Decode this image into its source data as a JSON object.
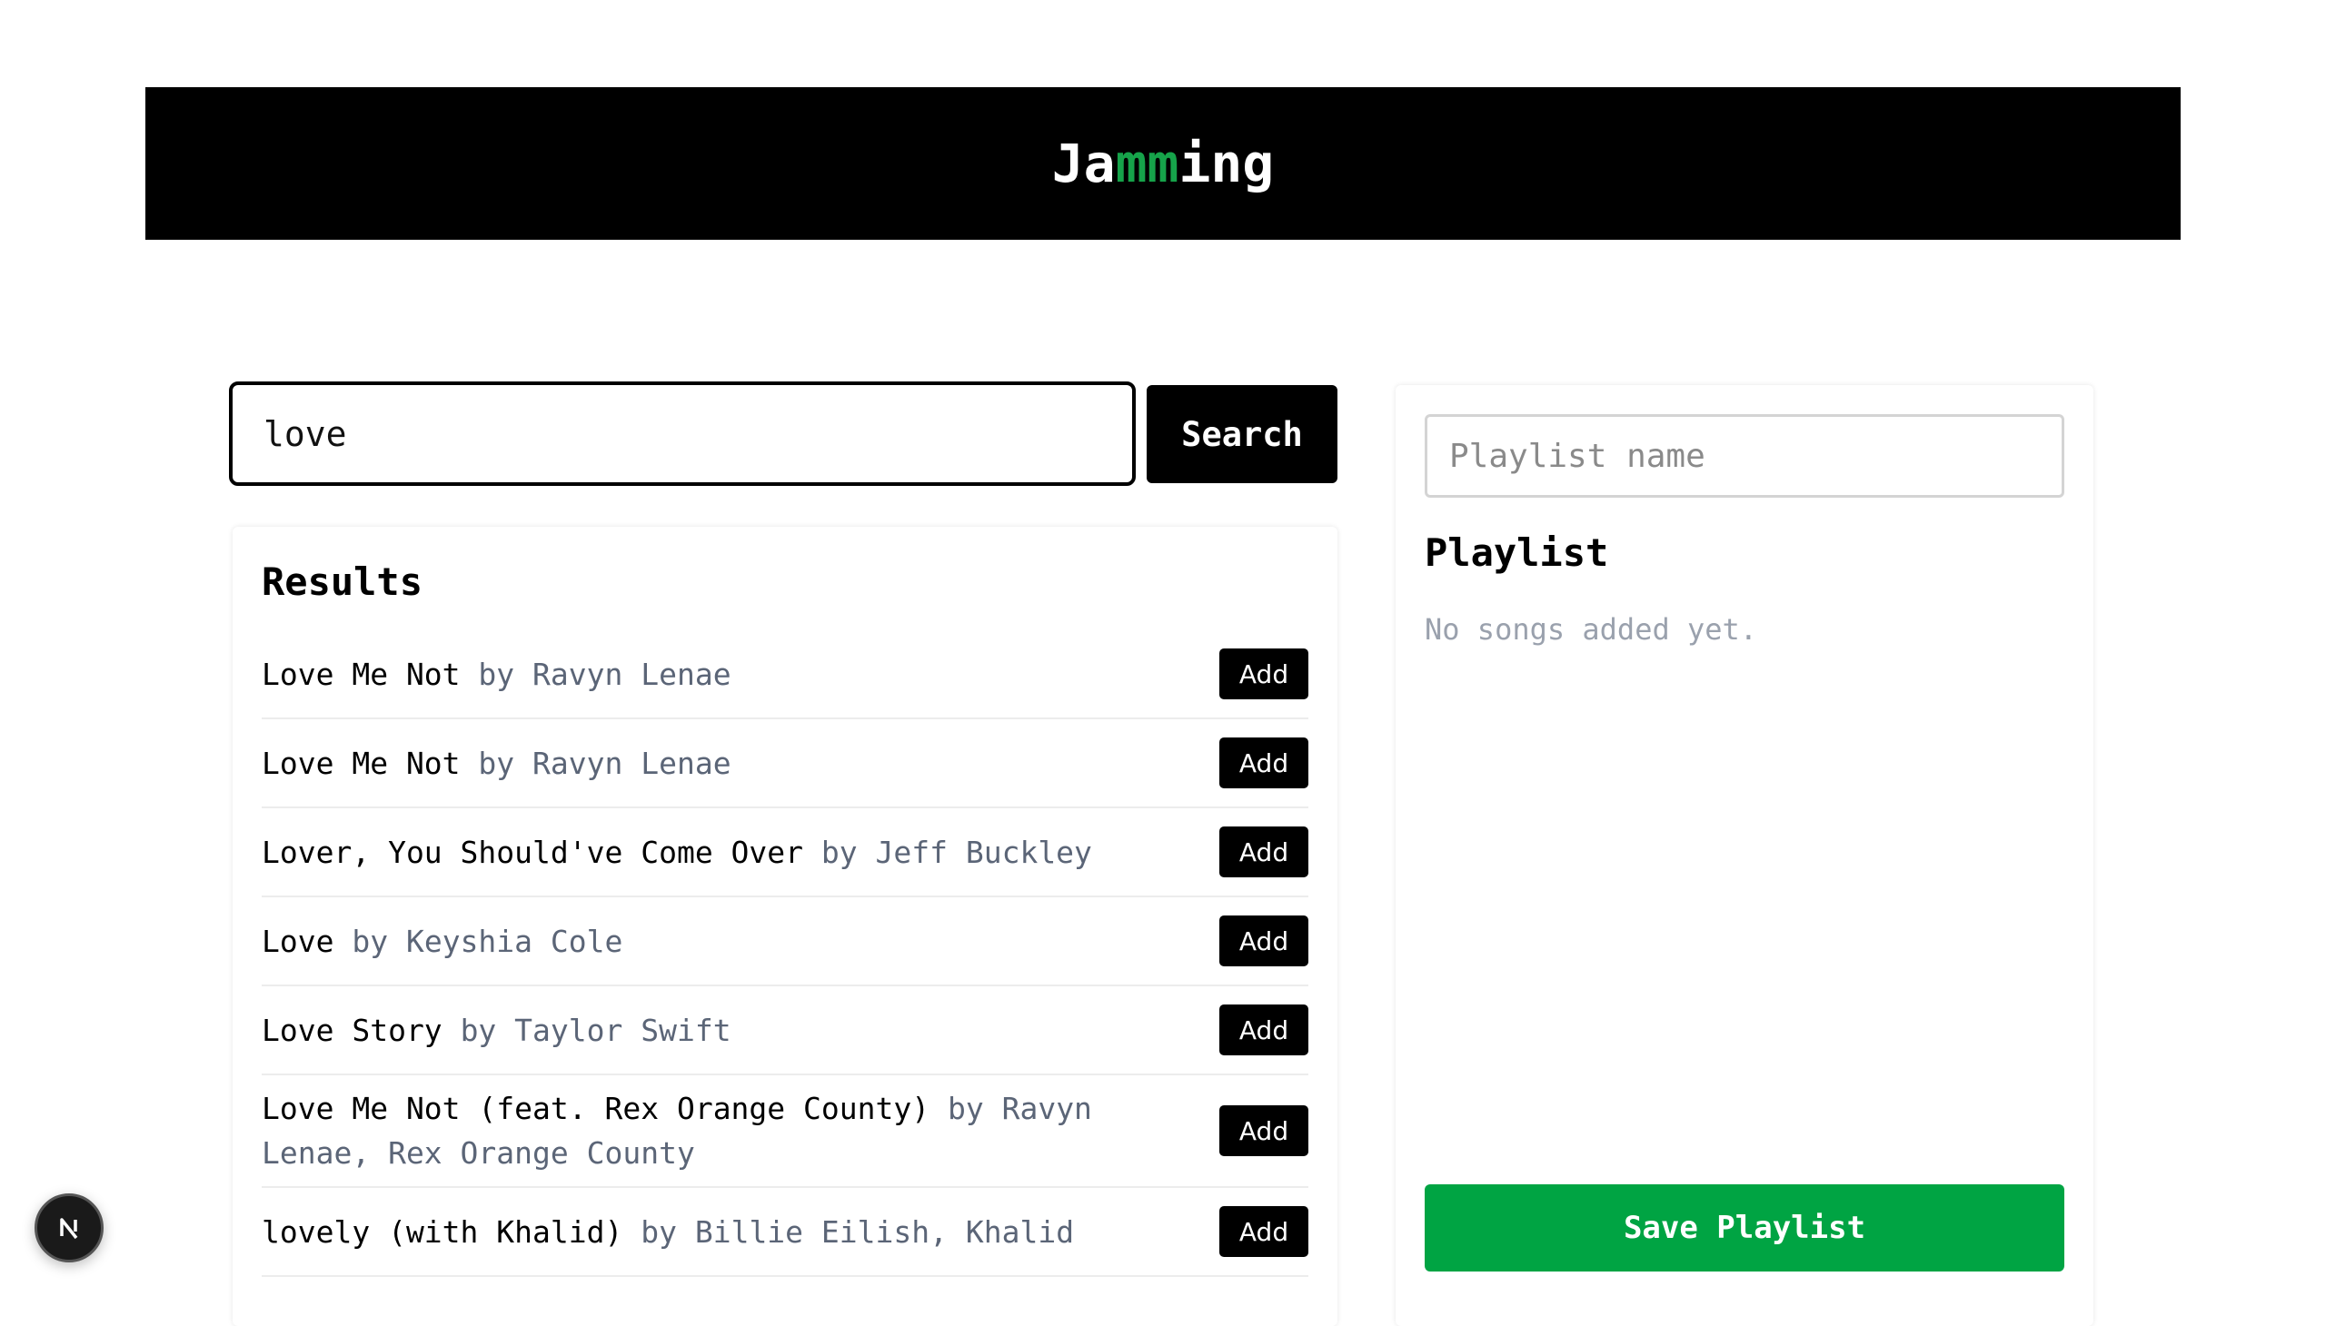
{
  "app": {
    "logo_part1": "Ja",
    "logo_accent": "mm",
    "logo_part2": "ing",
    "accent_color": "#16a34a"
  },
  "search": {
    "value": "love",
    "button_label": "Search"
  },
  "results": {
    "title": "Results",
    "add_label": "Add",
    "tracks": [
      {
        "name": "Love Me Not",
        "artist": "by Ravyn Lenae"
      },
      {
        "name": "Love Me Not",
        "artist": "by Ravyn Lenae"
      },
      {
        "name": "Lover, You Should've Come Over",
        "artist": "by Jeff Buckley"
      },
      {
        "name": "Love",
        "artist": "by Keyshia Cole"
      },
      {
        "name": "Love Story",
        "artist": "by Taylor Swift"
      },
      {
        "name": "Love Me Not (feat. Rex Orange County)",
        "artist": "by Ravyn Lenae, Rex Orange County"
      },
      {
        "name": "lovely (with Khalid)",
        "artist": "by Billie Eilish, Khalid"
      }
    ]
  },
  "playlist": {
    "name_placeholder": "Playlist name",
    "title": "Playlist",
    "empty_text": "No songs added yet.",
    "save_label": "Save Playlist",
    "save_color": "#00a443"
  },
  "badge": {
    "icon": "nextjs-icon"
  }
}
